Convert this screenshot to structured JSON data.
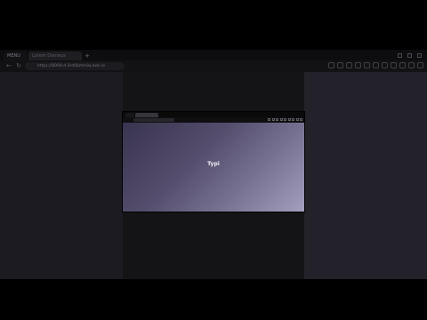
{
  "back_window": {
    "tabs": [
      {
        "label": "MENU"
      },
      {
        "label": "Lorem Domeus"
      }
    ],
    "new_tab_glyph": "+",
    "url": "https://8000-d-3rd4bmmiw.aws.io",
    "nav_icons": [
      "back-icon",
      "reload-icon"
    ]
  },
  "front_window": {
    "center_text": "Typi",
    "background_colors": [
      "#393450",
      "#a49ebd"
    ]
  }
}
